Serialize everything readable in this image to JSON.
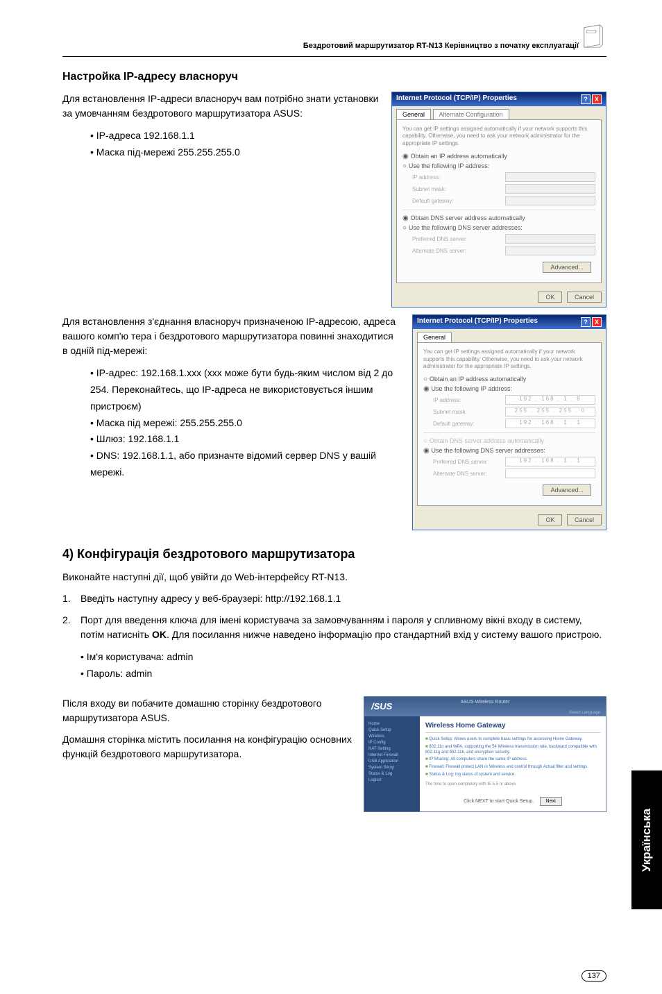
{
  "header": {
    "text": "Бездротовий маршрутизатор RT-N13 Керівництво з початку експлуатації"
  },
  "s1": {
    "title": "Настройка IP-адресу власноруч",
    "para": "Для встановлення IP-адреси власноруч вам потрібно знати установки за умовчанням бездротового маршрутизатора ASUS:",
    "b1": "IP-адреса 192.168.1.1",
    "b2": "Маска під-мережі 255.255.255.0"
  },
  "dlg1": {
    "title": "Internet Protocol (TCP/IP) Properties",
    "tab1": "General",
    "tab2": "Alternate Configuration",
    "desc": "You can get IP settings assigned automatically if your network supports this capability. Otherwise, you need to ask your network administrator for the appropriate IP settings.",
    "r1": "Obtain an IP address automatically",
    "r2": "Use the following IP address:",
    "f1": "IP address:",
    "f2": "Subnet mask:",
    "f3": "Default gateway:",
    "r3": "Obtain DNS server address automatically",
    "r4": "Use the following DNS server addresses:",
    "f4": "Preferred DNS server:",
    "f5": "Alternate DNS server:",
    "adv": "Advanced...",
    "ok": "OK",
    "cancel": "Cancel"
  },
  "s2": {
    "para": "Для встановлення з'єднання власноруч призначеною IP-адресою, адреса вашого комп'ю тера і бездротового маршрутизатора повинні знаходитися в одній під-мережі:",
    "b1": "IP-адрес: 192.168.1.xxx (xxx може бути будь-яким числом від   2 до 254. Переконайтесь, що IP-адреса не використовується іншим пристроєм)",
    "b2": "Маска під мережі: 255.255.255.0",
    "b3": "Шлюз: 192.168.1.1",
    "b4": "DNS: 192.168.1.1, або призначте відомий сервер DNS у вашій мережі."
  },
  "dlg2": {
    "title": "Internet Protocol (TCP/IP) Properties",
    "tab1": "General",
    "desc": "You can get IP settings assigned automatically if your network supports this capability. Otherwise, you need to ask your network administrator for the appropriate IP settings.",
    "r1": "Obtain an IP address automatically",
    "r2": "Use the following IP address:",
    "f1": "IP address:",
    "v1": "192 . 168 .  1 .  8",
    "f2": "Subnet mask:",
    "v2": "255 . 255 . 255 .  0",
    "f3": "Default gateway:",
    "v3": "192 . 168 .  1 .  1",
    "r3": "Obtain DNS server address automatically",
    "r4": "Use the following DNS server addresses:",
    "f4": "Preferred DNS server:",
    "v4": "192 . 168 .  1 .  1",
    "f5": "Alternate DNS server:",
    "adv": "Advanced...",
    "ok": "OK",
    "cancel": "Cancel"
  },
  "s3": {
    "heading": "4) Конфігурація бездротового маршрутизатора",
    "intro": "Виконайте наступні дії, щоб увійти до Web-інтерфейсу RT-N13.",
    "n1": "Введіть наступну адресу у веб-браузері: http://192.168.1.1",
    "n2a": "Порт для введення ключа для імені користувача за замовчуванням і пароля у спливному вікні входу в систему, потім натисніть ",
    "n2b": "OK",
    "n2c": ". Для посилання нижче наведено інформацію про стандартний вхід у систему вашого пристрою.",
    "sb1": "Ім'я користувача: admin",
    "sb2": "Пароль: admin",
    "p2": "Після входу ви побачите домашню сторінку бездротового маршрутизатора ASUS.",
    "p3": "Домашня сторінка містить посилання на конфігурацію основних функцій бездротового маршрутизатора."
  },
  "router": {
    "brand": "/SUS",
    "topline": "ASUS Wireless Router",
    "lang": "Select Language",
    "side": [
      "Home",
      "Quick Setup",
      "Wireless",
      "IP Config",
      "NAT Setting",
      "Internet Firewall",
      "USB Application",
      "System Setup",
      "Status & Log",
      "Logout"
    ],
    "title": "Wireless Home Gateway",
    "bul": [
      "Quick Setup: Allows users to complete basic settings for accessing Home Gateway.",
      "802.11n and WPA, supporting the 54 Wireless transmission rate, backward compatible with 802.11g and 802.11b, and encryption security.",
      "IP Sharing: All computers share the same IP address.",
      "Firewall: Firewall protect LAN or Wireless and control through Actual filter and settings.",
      "Status & Log: log status of system and service."
    ],
    "note": "The time to open completely with IE 5.5 or above.",
    "next": "Click NEXT to start Quick Setup.",
    "nextbtn": "Next"
  },
  "sidetab": "Українська",
  "pagenum": "137"
}
